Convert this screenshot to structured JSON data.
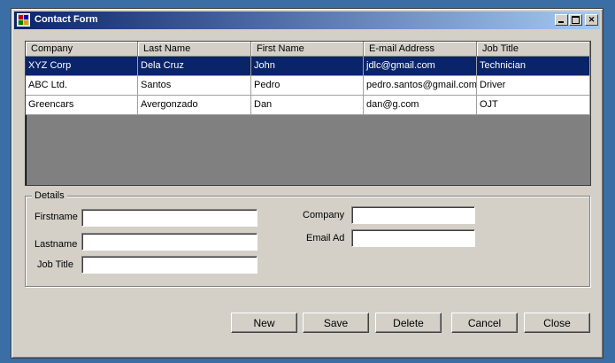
{
  "window": {
    "title": "Contact Form"
  },
  "grid": {
    "columns": [
      "Company",
      "Last Name",
      "First Name",
      "E-mail Address",
      "Job Title"
    ],
    "rows": [
      {
        "company": "XYZ Corp",
        "last_name": "Dela Cruz",
        "first_name": "John",
        "email": "jdlc@gmail.com",
        "job_title": "Technician",
        "selected": true
      },
      {
        "company": "ABC Ltd.",
        "last_name": "Santos",
        "first_name": "Pedro",
        "email": "pedro.santos@gmail.com",
        "job_title": "Driver",
        "selected": false
      },
      {
        "company": "Greencars",
        "last_name": "Avergonzado",
        "first_name": "Dan",
        "email": "dan@g.com",
        "job_title": "OJT",
        "selected": false
      }
    ]
  },
  "details": {
    "legend": "Details",
    "firstname_label": "Firstname",
    "firstname_value": "",
    "lastname_label": "Lastname",
    "lastname_value": "",
    "jobtitle_label": "Job Title",
    "jobtitle_value": "",
    "company_label": "Company",
    "company_value": "",
    "email_label": "Email Ad",
    "email_value": ""
  },
  "buttons": {
    "new": "New",
    "save": "Save",
    "delete": "Delete",
    "cancel": "Cancel",
    "close": "Close"
  },
  "colors": {
    "desktop": "#3a6ea5",
    "selection": "#0a246a",
    "face": "#d4d0c8"
  }
}
